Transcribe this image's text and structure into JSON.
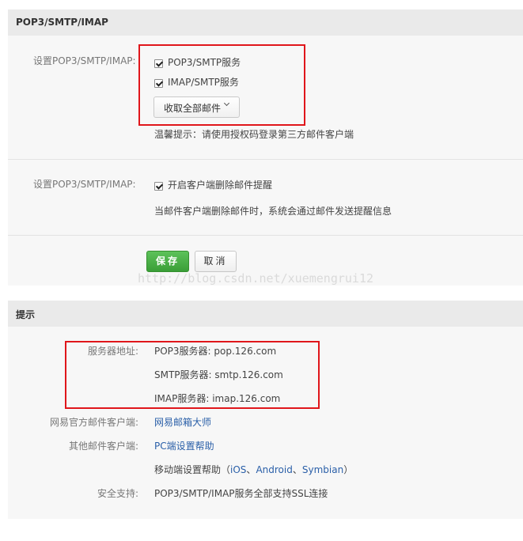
{
  "section1": {
    "title": "POP3/SMTP/IMAP",
    "row1_label": "设置POP3/SMTP/IMAP:",
    "pop3_checkbox_label": "POP3/SMTP服务",
    "imap_checkbox_label": "IMAP/SMTP服务",
    "receive_select": "收取全部邮件",
    "tip": "温馨提示：请使用授权码登录第三方邮件客户端",
    "row2_label": "设置POP3/SMTP/IMAP:",
    "delete_reminder_label": "开启客户端删除邮件提醒",
    "delete_reminder_desc": "当邮件客户端删除邮件时，系统会通过邮件发送提醒信息",
    "save_button": "保存",
    "cancel_button": "取消"
  },
  "watermark": "http://blog.csdn.net/xuemengrui12",
  "section2": {
    "title": "提示",
    "server_label": "服务器地址:",
    "pop3_server": "POP3服务器: pop.126.com",
    "smtp_server": "SMTP服务器: smtp.126.com",
    "imap_server": "IMAP服务器: imap.126.com",
    "official_client_label": "网易官方邮件客户端:",
    "official_client_link": "网易邮箱大师",
    "other_client_label": "其他邮件客户端:",
    "pc_help_link": "PC端设置帮助",
    "mobile_help_prefix": "移动端设置帮助（",
    "mobile_ios": "iOS",
    "mobile_sep1": "、",
    "mobile_android": "Android",
    "mobile_sep2": "、",
    "mobile_symbian": "Symbian",
    "mobile_help_suffix": "）",
    "security_label": "安全支持:",
    "security_value": "POP3/SMTP/IMAP服务全部支持SSL连接"
  },
  "colors": {
    "highlight_box": "#e0161b",
    "save_button": "#3a9e37",
    "link": "#2a5fa8"
  }
}
